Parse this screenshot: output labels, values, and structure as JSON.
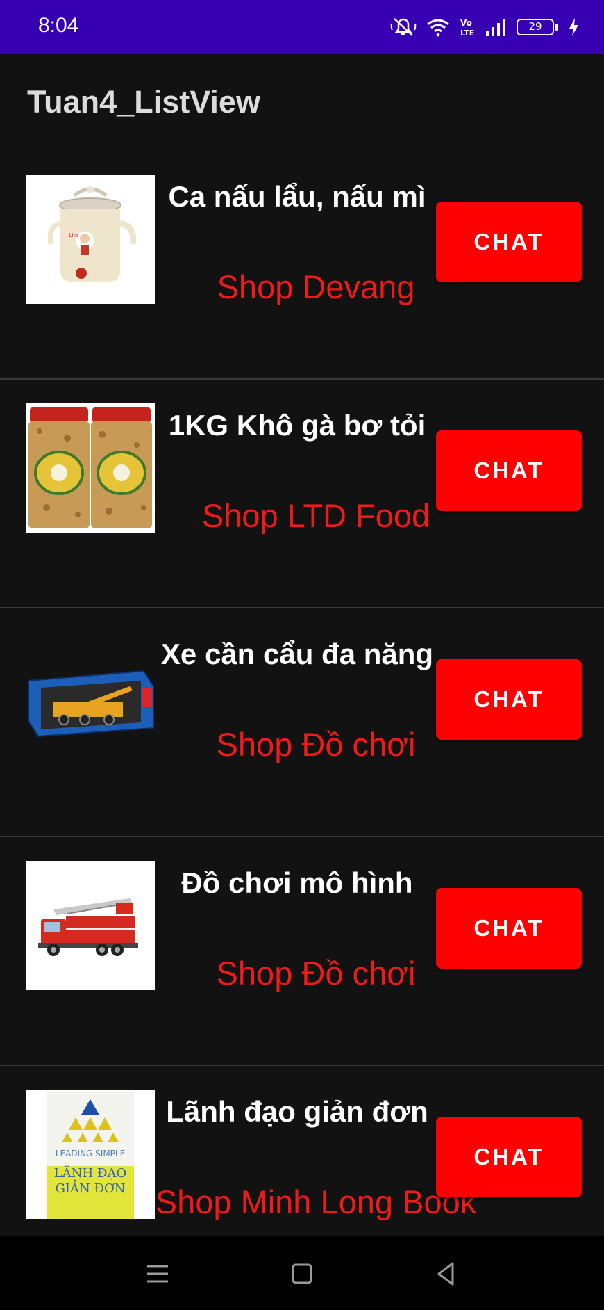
{
  "status_bar": {
    "time": "8:04",
    "battery": "29",
    "icons": [
      "mute-icon",
      "wifi-icon",
      "volte-icon",
      "signal-icon",
      "battery-icon",
      "charging-icon"
    ]
  },
  "app_bar": {
    "title": "Tuan4_ListView"
  },
  "items": [
    {
      "title": "Ca nấu lẩu, nấu mì",
      "shop": "Shop Devang",
      "button": "CHAT",
      "image": "electric-pot"
    },
    {
      "title": "1KG Khô gà bơ tỏi",
      "shop": "Shop LTD Food",
      "button": "CHAT",
      "image": "dried-chicken-jars"
    },
    {
      "title": "Xe cần cẩu đa năng",
      "shop": "Shop Đồ chơi",
      "button": "CHAT",
      "image": "crane-toy-box"
    },
    {
      "title": "Đồ chơi mô hình",
      "shop": "Shop Đồ chơi",
      "button": "CHAT",
      "image": "fire-truck-model"
    },
    {
      "title": "Lãnh đạo giản đơn",
      "shop": "Shop Minh Long Book",
      "button": "CHAT",
      "image": "book-cover",
      "image_text": {
        "top": "LEADING SIMPLE",
        "line1": "LÃNH ĐẠO",
        "line2": "GIẢN ĐƠN"
      }
    }
  ],
  "colors": {
    "status_bar": "#3700b3",
    "background": "#121212",
    "accent_red": "#ff0000",
    "shop_text": "#f01a1a"
  },
  "nav_bar": {
    "buttons": [
      "menu-icon",
      "home-icon",
      "back-icon"
    ]
  }
}
